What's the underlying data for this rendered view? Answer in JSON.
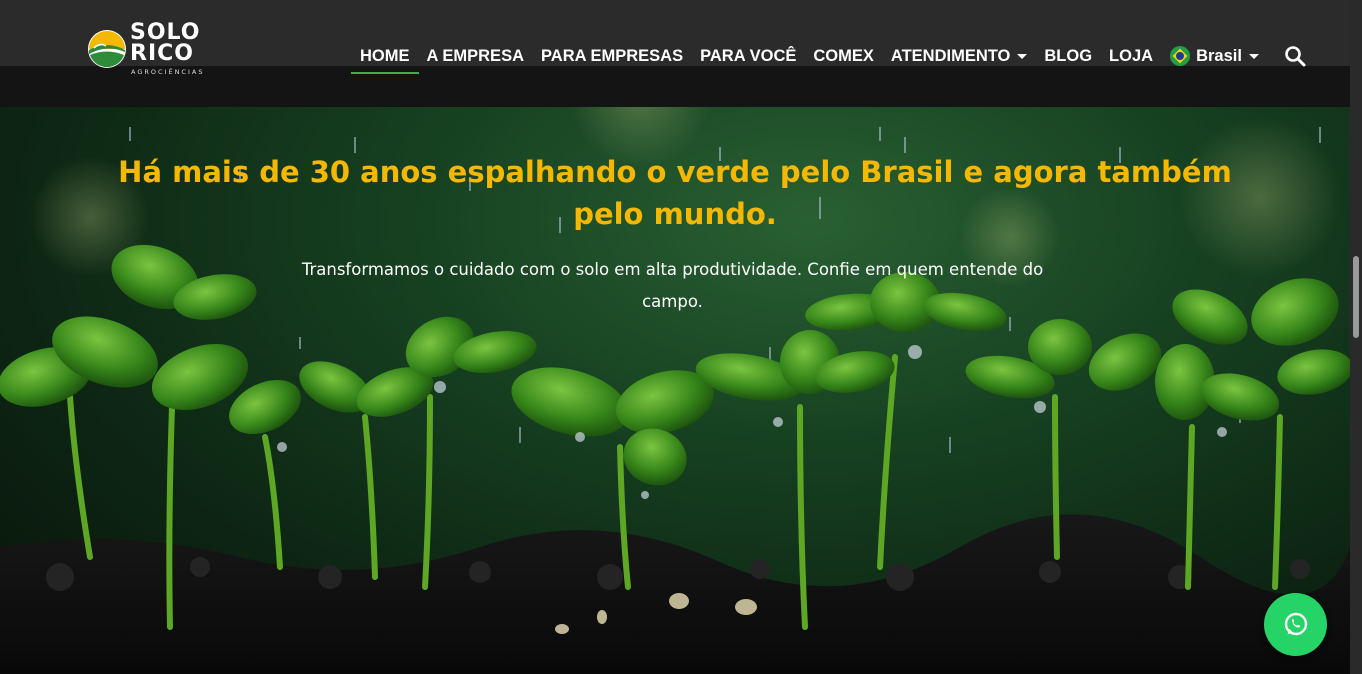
{
  "brand": {
    "name_line1": "SOLO",
    "name_line2": "RICO",
    "tagline": "AGROCIÊNCIAS",
    "colors": {
      "green": "#2e8b3a",
      "yellow": "#f5b800"
    }
  },
  "nav": {
    "items": [
      {
        "label": "HOME",
        "active": true
      },
      {
        "label": "A EMPRESA"
      },
      {
        "label": "PARA EMPRESAS"
      },
      {
        "label": "PARA VOCÊ"
      },
      {
        "label": "COMEX"
      },
      {
        "label": "ATENDIMENTO",
        "dropdown": true
      },
      {
        "label": "BLOG"
      },
      {
        "label": "LOJA"
      }
    ],
    "language": {
      "label": "Brasil",
      "icon": "brazil-flag-icon"
    },
    "search_icon": "search-icon"
  },
  "hero": {
    "title": "Há mais de 30 anos espalhando o verde pelo Brasil e agora também pelo mundo.",
    "subtitle": "Transformamos o cuidado com o solo em alta produtividade. Confie em quem entende do campo.",
    "title_color": "#f5b800"
  },
  "whatsapp": {
    "icon": "whatsapp-icon",
    "color": "#25d366"
  }
}
